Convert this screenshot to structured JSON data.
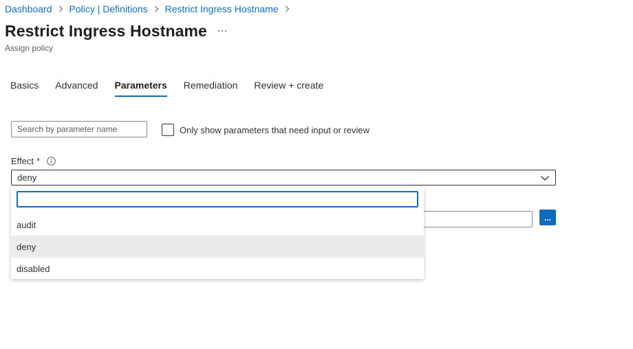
{
  "breadcrumb": [
    "Dashboard",
    "Policy | Definitions",
    "Restrict Ingress Hostname"
  ],
  "page": {
    "title": "Restrict Ingress Hostname",
    "subtitle": "Assign policy",
    "more_label": "···"
  },
  "tabs": [
    {
      "label": "Basics",
      "active": false
    },
    {
      "label": "Advanced",
      "active": false
    },
    {
      "label": "Parameters",
      "active": true
    },
    {
      "label": "Remediation",
      "active": false
    },
    {
      "label": "Review + create",
      "active": false
    }
  ],
  "filters": {
    "search_placeholder": "Search by parameter name",
    "search_value": "",
    "checkbox_label": "Only show parameters that need input or review",
    "checkbox_checked": false
  },
  "effect": {
    "label": "Effect",
    "required_mark": "*",
    "value": "deny",
    "filter_value": "",
    "options": [
      "audit",
      "deny",
      "disabled"
    ],
    "selected": "deny"
  },
  "ellipsis_button_label": "...",
  "colors": {
    "accent": "#0f6cbd",
    "required": "#c50f1f",
    "selected_row": "#edebe9"
  }
}
